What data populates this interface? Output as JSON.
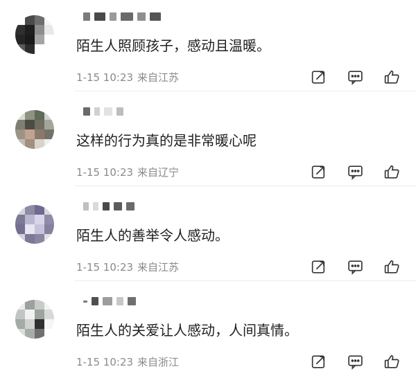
{
  "comments": [
    {
      "content": "陌生人照顾孩子，感动且温暖。",
      "time": "1-15 10:23",
      "location": "来自江苏"
    },
    {
      "content": "这样的行为真的是非常暖心呢",
      "time": "1-15 10:23",
      "location": "来自辽宁"
    },
    {
      "content": "陌生人的善举令人感动。",
      "time": "1-15 10:23",
      "location": "来自江苏"
    },
    {
      "content": "陌生人的关爱让人感动，人间真情。",
      "time": "1-15 10:23",
      "location": "来自浙江"
    }
  ],
  "icons": {
    "share": "share-icon",
    "comment": "comment-icon",
    "like": "like-icon"
  },
  "colors": {
    "text": "#1f1f1f",
    "meta": "#8a8a8a",
    "icon": "#333333",
    "divider": "#ececec"
  }
}
